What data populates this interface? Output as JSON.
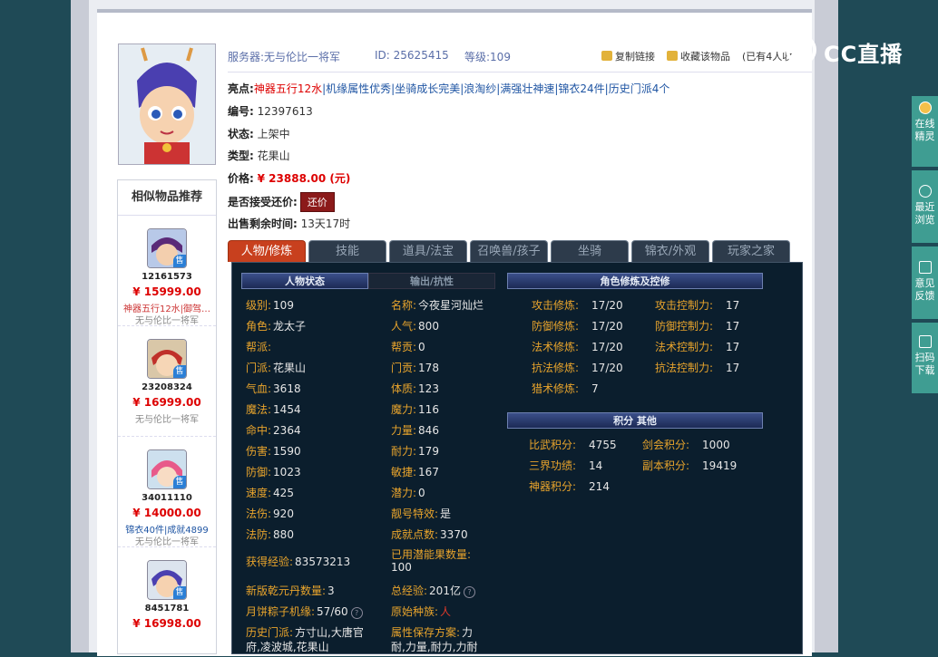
{
  "header": {
    "server_label": "服务器:",
    "server_value": "无与伦比一将军",
    "id_label": "ID:",
    "id_value": "25625415",
    "level_label": "等级:",
    "level_value": "109",
    "copy_link": "复制链接",
    "favorite": "收藏该物品",
    "favorite_count": "(已有4人收"
  },
  "overlay": {
    "brand": "CC直播"
  },
  "info": {
    "highlights_label": "亮点:",
    "highlights": [
      "神器五行12水",
      "机缘属性优秀",
      "坐骑成长完美",
      "浪淘纱",
      "满强壮神速",
      "锦衣24件",
      "历史门派4个"
    ],
    "serial_label": "编号:",
    "serial_value": "12397613",
    "status_label": "状态:",
    "status_value": "上架中",
    "type_label": "类型:",
    "type_value": "花果山",
    "price_label": "价格:",
    "price_value": "¥ 23888.00 (元)",
    "haggle_label": "是否接受还价:",
    "haggle_button": "还价",
    "remaining_label": "出售剩余时间:",
    "remaining_value": "13天17时"
  },
  "sidebar": {
    "title": "相似物品推荐",
    "tag": "售",
    "items": [
      {
        "id": "12161573",
        "price": "¥ 15999.00",
        "desc": "神器五行12水|御驾…",
        "server": "无与伦比一将军"
      },
      {
        "id": "23208324",
        "price": "¥ 16999.00",
        "desc": "",
        "server": "无与伦比一将军"
      },
      {
        "id": "34011110",
        "price": "¥ 14000.00",
        "desc": "锦衣40件|成就4899",
        "server": "无与伦比一将军"
      },
      {
        "id": "8451781",
        "price": "¥ 16998.00",
        "desc": "",
        "server": ""
      }
    ]
  },
  "tabs": [
    "人物/修炼",
    "技能",
    "道具/法宝",
    "召唤兽/孩子",
    "坐骑",
    "锦衣/外观",
    "玩家之家"
  ],
  "panel": {
    "hdr_status": "人物状态",
    "hdr_output": "输出/抗性",
    "hdr_cultivation": "角色修炼及控修",
    "hdr_score": "积分 其他",
    "left": [
      {
        "k": "级别:",
        "v": "109"
      },
      {
        "k": "角色:",
        "v": "龙太子"
      },
      {
        "k": "帮派:",
        "v": ""
      },
      {
        "k": "门派:",
        "v": "花果山"
      },
      {
        "k": "气血:",
        "v": "3618"
      },
      {
        "k": "魔法:",
        "v": "1454"
      },
      {
        "k": "命中:",
        "v": "2364"
      },
      {
        "k": "伤害:",
        "v": "1590"
      },
      {
        "k": "防御:",
        "v": "1023"
      },
      {
        "k": "速度:",
        "v": "425"
      },
      {
        "k": "法伤:",
        "v": "920"
      },
      {
        "k": "法防:",
        "v": "880"
      }
    ],
    "right": [
      {
        "k": "名称:",
        "v": "今夜星河灿烂"
      },
      {
        "k": "人气:",
        "v": "800"
      },
      {
        "k": "帮贡:",
        "v": "0"
      },
      {
        "k": "门贡:",
        "v": "178"
      },
      {
        "k": "体质:",
        "v": "123"
      },
      {
        "k": "魔力:",
        "v": "116"
      },
      {
        "k": "力量:",
        "v": "846"
      },
      {
        "k": "耐力:",
        "v": "179"
      },
      {
        "k": "敏捷:",
        "v": "167"
      },
      {
        "k": "潜力:",
        "v": "0"
      },
      {
        "k": "靓号特效:",
        "v": "是"
      },
      {
        "k": "成就点数:",
        "v": "3370"
      }
    ],
    "exp_label": "获得经验:",
    "exp_value": "83573213",
    "potential_label": "已用潜能果数量:",
    "potential_value": "100",
    "qianyuan_label": "新版乾元丹数量:",
    "qianyuan_value": "3",
    "total_exp_label": "总经验:",
    "total_exp_value": "201亿",
    "mooncake_label": "月饼粽子机缘:",
    "mooncake_value": "57/60",
    "origin_label": "原始种族:",
    "origin_value": "人",
    "history_label": "历史门派:",
    "history_value1": "方寸山,大唐官",
    "history_value2": "府,凌波城,花果山",
    "attr_label": "属性保存方案:",
    "attr_value1": "力",
    "attr_value2": "耐,力量,耐力,力耐",
    "cultivation": [
      {
        "k": "攻击修炼:",
        "v": "17/20",
        "k2": "攻击控制力:",
        "v2": "17"
      },
      {
        "k": "防御修炼:",
        "v": "17/20",
        "k2": "防御控制力:",
        "v2": "17"
      },
      {
        "k": "法术修炼:",
        "v": "17/20",
        "k2": "法术控制力:",
        "v2": "17"
      },
      {
        "k": "抗法修炼:",
        "v": "17/20",
        "k2": "抗法控制力:",
        "v2": "17"
      },
      {
        "k": "猎术修炼:",
        "v": "7",
        "k2": "",
        "v2": ""
      }
    ],
    "scores": [
      {
        "k": "比武积分:",
        "v": "4755",
        "k2": "剑会积分:",
        "v2": "1000"
      },
      {
        "k": "三界功绩:",
        "v": "14",
        "k2": "副本积分:",
        "v2": "19419"
      },
      {
        "k": "神器积分:",
        "v": "214",
        "k2": "",
        "v2": ""
      }
    ]
  },
  "rail": {
    "online": [
      "在线",
      "精灵"
    ],
    "recent": [
      "最近",
      "浏览"
    ],
    "feedback": [
      "意见",
      "反馈"
    ],
    "scan": [
      "扫码",
      "下载"
    ]
  }
}
